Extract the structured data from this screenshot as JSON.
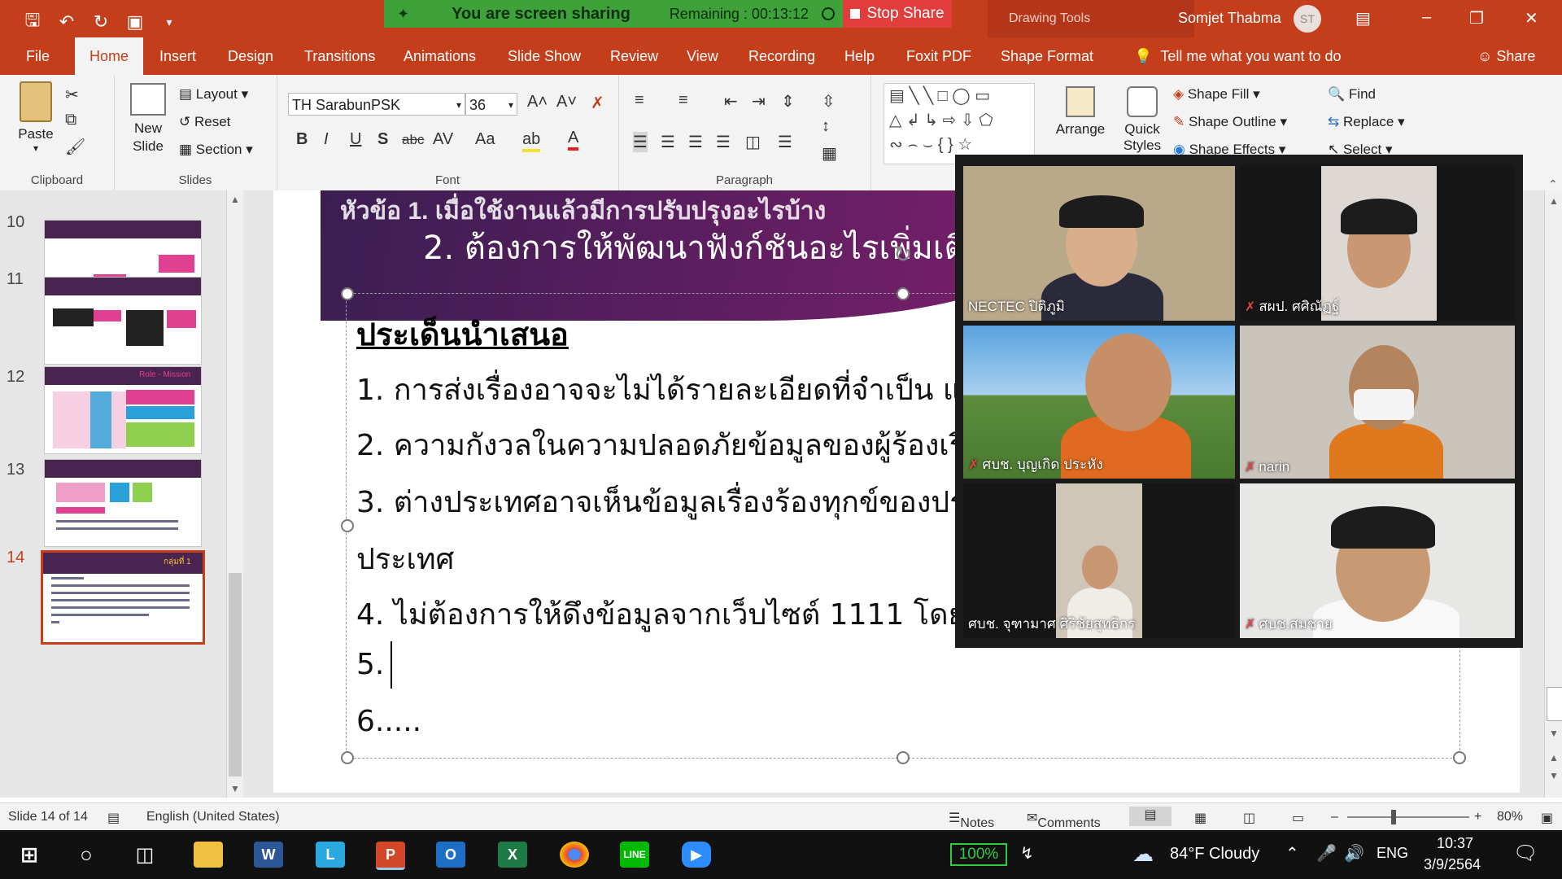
{
  "titlebar": {
    "sharing_status": "You are screen sharing",
    "remaining": "Remaining : 00:13:12",
    "stop_share": "Stop Share",
    "drawing_tools": "Drawing Tools",
    "user_name": "Somjet Thabma",
    "avatar_initials": "ST"
  },
  "tabs": [
    "File",
    "Home",
    "Insert",
    "Design",
    "Transitions",
    "Animations",
    "Slide Show",
    "Review",
    "View",
    "Recording",
    "Help",
    "Foxit PDF",
    "Shape Format"
  ],
  "tell_me": "Tell me what you want to do",
  "share": "Share",
  "ribbon": {
    "clipboard": {
      "paste": "Paste",
      "label": "Clipboard"
    },
    "slides": {
      "new_slide": "New Slide",
      "layout": "Layout",
      "reset": "Reset",
      "section": "Section",
      "label": "Slides"
    },
    "font": {
      "font_name": "TH SarabunPSK",
      "font_size": "36",
      "label": "Font"
    },
    "paragraph": {
      "label": "Paragraph"
    },
    "drawing": {
      "arrange": "Arrange",
      "quick_styles": "Quick Styles",
      "shape_fill": "Shape Fill",
      "shape_outline": "Shape Outline",
      "shape_effects": "Shape Effects"
    },
    "editing": {
      "find": "Find",
      "replace": "Replace",
      "select": "Select"
    }
  },
  "thumbnails": {
    "numbers": [
      "10",
      "11",
      "12",
      "13",
      "14"
    ],
    "selected": "14",
    "t12_label": "Role - Mission",
    "t14_label": "กลุ่มที่ 1"
  },
  "slide": {
    "banner_line1": "หัวข้อ 1. เมื่อใช้งานแล้วมีการปรับปรุงอะไรบ้าง",
    "banner_line2": "2. ต้องการให้พัฒนาฟังก์ชันอะไรเพิ่มเติม",
    "heading": "ประเด็นนำเสนอ",
    "items": [
      "1. การส่งเรื่องอาจจะไม่ได้รายละเอียดที่จำเป็น แล",
      "2. ความกังวลในความปลอดภัยข้อมูลของผู้ร้องเรีย",
      "3. ต่างประเทศอาจเห็นข้อมูลเรื่องร้องทุกข์ของประ",
      "ประเทศ",
      "4. ไม่ต้องการให้ดึงข้อมูลจากเว็บไซต์ 1111 โดยต",
      "5.",
      "6....."
    ]
  },
  "participants": [
    {
      "name": "NECTEC ปิติภูมิ",
      "muted": false
    },
    {
      "name": "สผป. ศศิณัฏฐ์",
      "muted": true
    },
    {
      "name": "ศบช. บุญเกิด ประหัง",
      "muted": true
    },
    {
      "name": "narin",
      "muted": true
    },
    {
      "name": "ศบช. จุฑามาศ ศิริชัยสุทธิกร",
      "muted": false
    },
    {
      "name": "ศบช.สมชาย",
      "muted": true
    }
  ],
  "statusbar": {
    "slide_info": "Slide 14 of 14",
    "language": "English (United States)",
    "notes": "Notes",
    "comments": "Comments",
    "zoom": "80%"
  },
  "taskbar": {
    "battery": "100%",
    "weather": "84°F Cloudy",
    "lang": "ENG",
    "time": "10:37",
    "date": "3/9/2564"
  },
  "colors": {
    "accent": "#c43e1c",
    "share_green": "#3ea13a",
    "stop_red": "#e23c3c",
    "banner": "#4a2450"
  }
}
